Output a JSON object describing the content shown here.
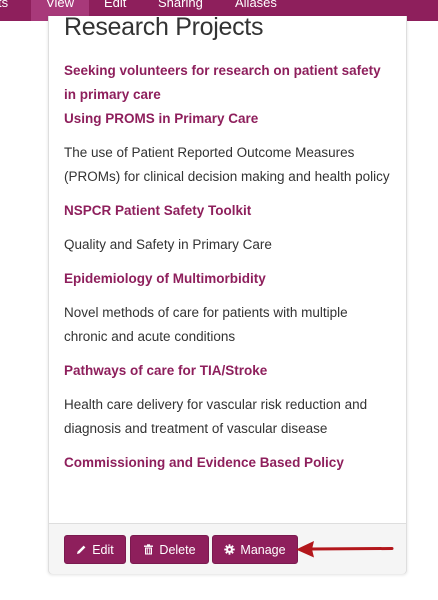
{
  "nav": {
    "items": [
      {
        "label": "ts"
      },
      {
        "label": "View"
      },
      {
        "label": "Edit"
      },
      {
        "label": "Sharing"
      },
      {
        "label": "Aliases"
      }
    ]
  },
  "card": {
    "title": "Research Projects",
    "projects": [
      {
        "title": "Seeking volunteers for research on patient safety in primary care",
        "description": ""
      },
      {
        "title": "Using PROMS in Primary Care",
        "description": "The use of Patient Reported Outcome Measures (PROMs) for clinical decision making and health policy"
      },
      {
        "title": "NSPCR Patient Safety Toolkit",
        "description": "Quality and Safety in Primary Care"
      },
      {
        "title": "Epidemiology of Multimorbidity",
        "description": "Novel methods of care for patients with multiple chronic and acute conditions"
      },
      {
        "title": "Pathways of care for TIA/Stroke",
        "description": "Health care delivery for vascular risk reduction and diagnosis and treatment of vascular disease"
      },
      {
        "title": "Commissioning and Evidence Based Policy",
        "description": ""
      }
    ]
  },
  "footer": {
    "edit_label": "Edit",
    "delete_label": "Delete",
    "manage_label": "Manage"
  },
  "icons": {
    "edit": "pencil-icon",
    "delete": "trash-icon",
    "manage": "gear-icon"
  },
  "colors": {
    "brand": "#8e1f5c",
    "nav_active": "#a8397a",
    "annotation_arrow": "#b3171c"
  }
}
